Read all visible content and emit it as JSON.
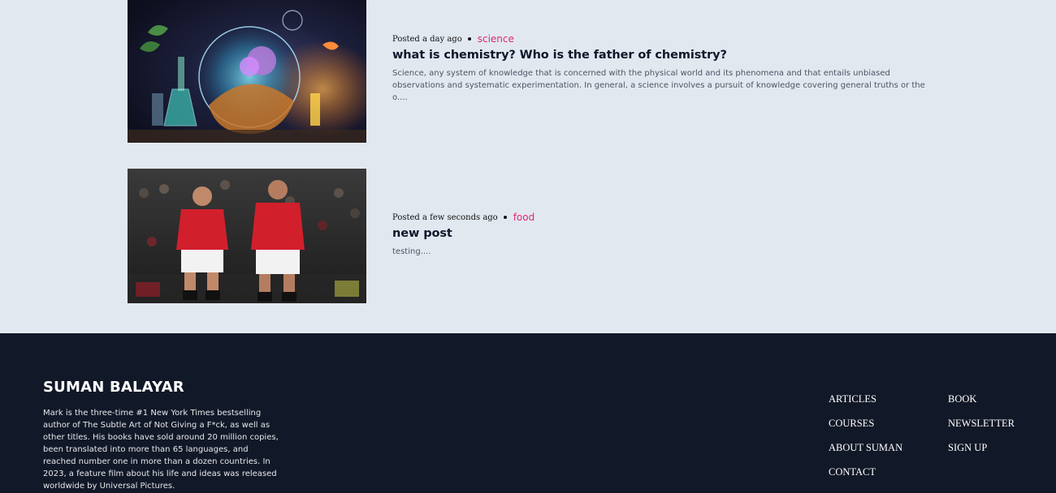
{
  "posts": [
    {
      "image_alt": "chemistry illustration with flasks and glowing liquids",
      "posted": "Posted a day ago",
      "category": "science",
      "title": "what is chemistry? Who is the father of chemistry?",
      "excerpt": "Science, any system of knowledge that is concerned with the physical world and its phenomena and that entails unbiased observations and systematic experimentation. In general, a science involves a pursuit of knowledge covering general truths or the o...."
    },
    {
      "image_alt": "two football players in red jerseys on the pitch",
      "posted": "Posted a few seconds ago",
      "category": "food",
      "title": "new post",
      "excerpt": "testing...."
    }
  ],
  "footer": {
    "brand": "SUMAN BALAYAR",
    "bio": "Mark is the three-time #1 New York Times bestselling author of The Subtle Art of Not Giving a F*ck, as well as other titles. His books have sold around 20 million copies, been translated into more than 65 languages, and reached number one in more than a dozen countries. In 2023, a feature film about his life and ideas was released worldwide by Universal Pictures.",
    "nav_col1": [
      "ARTICLES",
      "COURSES",
      "ABOUT SUMAN",
      "CONTACT"
    ],
    "nav_col2": [
      "BOOK",
      "NEWSLETTER",
      "SIGN UP"
    ]
  },
  "colors": {
    "page_bg": "#e2e8f0",
    "footer_bg": "#111827",
    "category": "#db2777"
  }
}
